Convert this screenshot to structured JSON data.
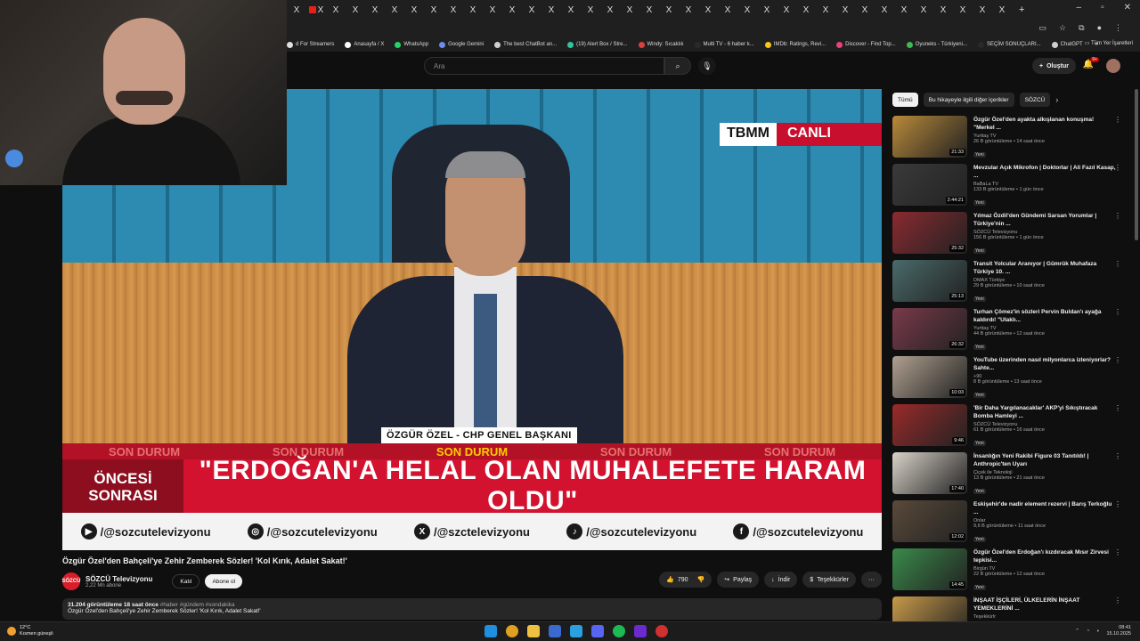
{
  "browser": {
    "tab_close_glyph": "X",
    "tab_count": 37,
    "new_tab_glyph": "+",
    "window_controls": [
      "–",
      "▫",
      "✕"
    ],
    "bookmarks": [
      {
        "label": "d For Streamers",
        "color": "#e0e0e0"
      },
      {
        "label": "Anasayfa / X",
        "color": "#ffffff"
      },
      {
        "label": "WhatsApp",
        "color": "#25d366"
      },
      {
        "label": "Google Gemini",
        "color": "#6d8cf0"
      },
      {
        "label": "The best ChatBot an...",
        "color": "#d0d0d0"
      },
      {
        "label": "(19) Alert Box / Stre...",
        "color": "#31c3a2"
      },
      {
        "label": "Windy: Sıcaklık",
        "color": "#d94040"
      },
      {
        "label": "Multi TV - 6 haber k...",
        "color": "#2a2a2a"
      },
      {
        "label": "IMDb: Ratings, Revi...",
        "color": "#f5c518"
      },
      {
        "label": "Discover - Find Top...",
        "color": "#e8417d"
      },
      {
        "label": "Oyuneks - Türkiyeni...",
        "color": "#3fb950"
      },
      {
        "label": "SEÇİM SONUÇLARI...",
        "color": "#2a2a2a"
      },
      {
        "label": "ChatGPT",
        "color": "#cfcfcf"
      }
    ],
    "bookmarks_more": "»",
    "all_bookmarks": "Tüm Yer İşaretleri"
  },
  "youtube": {
    "search_placeholder": "Ara",
    "create_label": "Oluştur",
    "notif_badge": "9+",
    "video": {
      "badge_left": "TBMM",
      "badge_right": "CANLI",
      "name_tag": "ÖZGÜR ÖZEL - CHP GENEL BAŞKANI",
      "ticker": [
        "SON DURUM",
        "SON DURUM",
        "SON DURUM",
        "SON DURUM",
        "SON DURUM"
      ],
      "segment_line1": "ÖNCESİ",
      "segment_line2": "SONRASI",
      "headline": "\"ERDOĞAN'A HELAL OLAN MUHALEFETE HARAM OLDU\"",
      "socials": [
        {
          "icon": "youtube-icon",
          "glyph": "▶",
          "handle": "/@sozcutelevizyonu"
        },
        {
          "icon": "instagram-icon",
          "glyph": "◎",
          "handle": "/@sozcutelevizyonu"
        },
        {
          "icon": "x-icon",
          "glyph": "X",
          "handle": "/@szctelevizyonu"
        },
        {
          "icon": "tiktok-icon",
          "glyph": "♪",
          "handle": "/@sozcutelevizyonu"
        },
        {
          "icon": "facebook-icon",
          "glyph": "f",
          "handle": "/@sozcutelevizyonu"
        }
      ]
    },
    "title": "Özgür Özel'den Bahçeli'ye Zehir Zemberek Sözler! 'Kol Kırık, Adalet Sakat!'",
    "channel": {
      "avatar_text": "SÖZCÜ",
      "name": "SÖZCÜ Televizyonu",
      "subs": "2,22 Mn abone",
      "join": "Katıl",
      "subscribe": "Abone ol"
    },
    "actions": {
      "likes": "790",
      "share": "Paylaş",
      "download": "İndir",
      "thanks": "Teşekkürler",
      "more": "···"
    },
    "description": {
      "meta": "31.204 görüntüleme  18 saat önce",
      "tags": "#haber #gündem #sondakika",
      "line": "Özgür Özel'den Bahçeli'ye Zehir Zemberek Sözler! 'Kol Kırık, Adalet Sakat!'"
    },
    "chips": [
      "Tümü",
      "Bu hikayeyle ilgili diğer içerikler",
      "SÖZCÜ"
    ],
    "recommendations": [
      {
        "title": "Özgür Özel'den ayakta alkışlanan konuşma! \"Merkel ...",
        "channel": "Yurttaş TV",
        "meta": "26 B görüntüleme • 14 saat önce",
        "duration": "21:33",
        "thumb": "#b98a3a",
        "new": "Yeni"
      },
      {
        "title": "Mevzular Açık Mikrofon | Doktorlar | Ali Fazıl Kasap, ...",
        "channel": "BaBaLa TV",
        "meta": "133 B görüntüleme • 1 gün önce",
        "duration": "2:44:21",
        "thumb": "#3a3a3a",
        "new": "Yeni"
      },
      {
        "title": "Yılmaz Özdil'den Gündemi Sarsan Yorumlar | Türkiye'nin ...",
        "channel": "SÖZCÜ Televizyonu",
        "meta": "156 B görüntüleme • 1 gün önce",
        "duration": "25:32",
        "thumb": "#8a2a30",
        "new": "Yeni"
      },
      {
        "title": "Transit Yolcular Aranıyor | Gümrük Muhafaza Türkiye 10. ...",
        "channel": "DMAX Türkiye",
        "meta": "29 B görüntüleme • 10 saat önce",
        "duration": "25:13",
        "thumb": "#4a6a6a",
        "new": "Yeni"
      },
      {
        "title": "Turhan Çömez'in sözleri Pervin Buldan'ı ayağa kaldırdı! \"Ulaklı...",
        "channel": "Yurttaş TV",
        "meta": "44 B görüntüleme • 12 saat önce",
        "duration": "26:32",
        "thumb": "#7a3a4a",
        "new": "Yeni"
      },
      {
        "title": "YouTube üzerinden nasıl milyonlarca izleniyorlar? Sahte...",
        "channel": "+90",
        "meta": "8 B görüntüleme • 13 saat önce",
        "duration": "10:03",
        "thumb": "#b0a090",
        "new": "Yeni"
      },
      {
        "title": "'Bir Daha Yargılanacaklar' AKP'yi Sıkıştıracak Bomba Hamleyi ...",
        "channel": "SÖZCÜ Televizyonu",
        "meta": "61 B görüntüleme • 16 saat önce",
        "duration": "9:46",
        "thumb": "#9a2a2a",
        "new": "Yeni"
      },
      {
        "title": "İnsanlığın Yeni Rakibi Figure 03 Tanıtıldı! | Anthropic'ten Uyarı",
        "channel": "Çiçek ile Teknoloji",
        "meta": "13 B görüntüleme • 21 saat önce",
        "duration": "17:40",
        "thumb": "#d8d2c8",
        "new": "Yeni"
      },
      {
        "title": "Eskişehir'de nadir element rezervi | Barış Terkoğlu ...",
        "channel": "Onlar",
        "meta": "9,6 B görüntüleme • 11 saat önce",
        "duration": "12:02",
        "thumb": "#5a4a3a",
        "new": "Yeni"
      },
      {
        "title": "Özgür Özel'den Erdoğan'ı kızdıracak Mısır Zirvesi tepkisi...",
        "channel": "Birgün TV",
        "meta": "22 B görüntüleme • 12 saat önce",
        "duration": "14:45",
        "thumb": "#3a8a4a",
        "new": "Yeni"
      },
      {
        "title": "İNŞAAT İŞÇİLERİ, ÜLKELERİN İNŞAAT YEMEKLERİNİ ...",
        "channel": "Teşekkürlr",
        "meta": "",
        "duration": "",
        "thumb": "#c89a4a",
        "new": ""
      }
    ]
  },
  "taskbar": {
    "temp": "12°C",
    "weather": "Kısmen güneşli",
    "time": "08:41",
    "date": "15.10.2025"
  }
}
